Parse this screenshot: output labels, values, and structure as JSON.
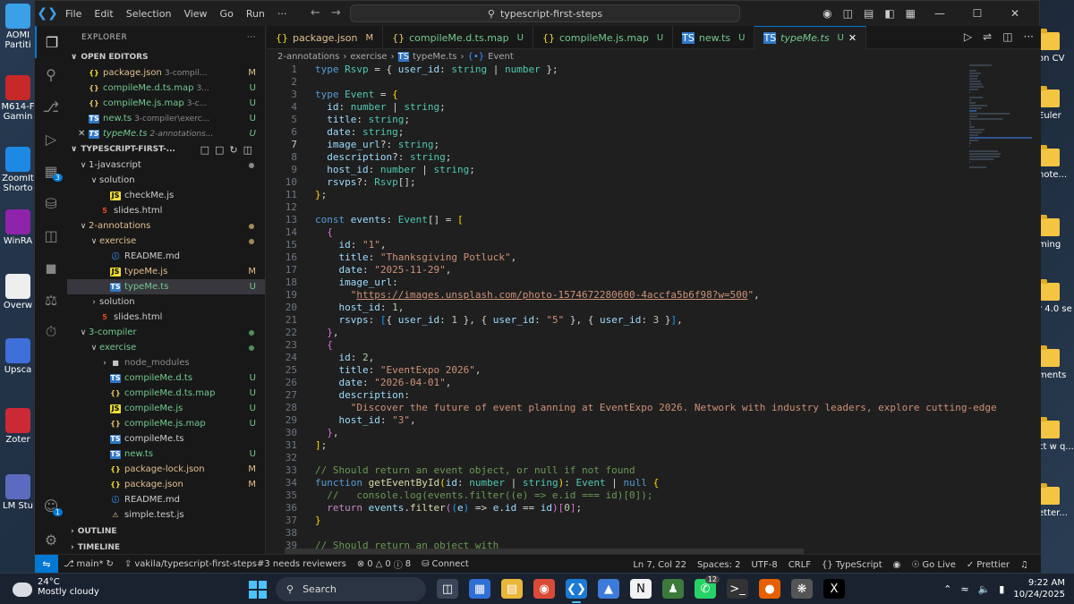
{
  "desktop": {
    "left_icons": [
      {
        "label": "AOMI Partiti",
        "color": "#3aa0e8"
      },
      {
        "label": "M614-F Gamin",
        "color": "#c62828"
      },
      {
        "label": "ZoomIt Shorto",
        "color": "#1e88e5"
      },
      {
        "label": "WinRA",
        "color": "#8e24aa"
      },
      {
        "label": "Overw",
        "color": "#eeeeee"
      },
      {
        "label": "Upsca",
        "color": "#3f6fd8"
      },
      {
        "label": "Zoter",
        "color": "#cc2936"
      },
      {
        "label": "LM Stu",
        "color": "#5c6bc0"
      }
    ],
    "right_icons": [
      {
        "label": "on CV"
      },
      {
        "label": "Euler"
      },
      {
        "label": "note..."
      },
      {
        "label": "ming"
      },
      {
        "label": "r 4.0 se"
      },
      {
        "label": "ments"
      },
      {
        "label": "ct w q..."
      },
      {
        "label": "etter..."
      }
    ]
  },
  "titlebar": {
    "menu": [
      "File",
      "Edit",
      "Selection",
      "View",
      "Go",
      "Run",
      "···"
    ],
    "search": "typescript-first-steps"
  },
  "activity": {
    "extensions_badge": "3",
    "accounts_badge": "1"
  },
  "sidebar": {
    "title": "EXPLORER",
    "open_editors_label": "OPEN EDITORS",
    "open_editors": [
      {
        "name": "package.json",
        "path": "3-compil...",
        "status": "M",
        "icon": "json"
      },
      {
        "name": "compileMe.d.ts.map",
        "path": "3...",
        "status": "U",
        "icon": "map"
      },
      {
        "name": "compileMe.js.map",
        "path": "3-c...",
        "status": "U",
        "icon": "map"
      },
      {
        "name": "new.ts",
        "path": "3-compiler\\exerc...",
        "status": "U",
        "icon": "ts"
      },
      {
        "name": "typeMe.ts",
        "path": "2-annotations...",
        "status": "U",
        "icon": "ts",
        "italic": true,
        "close": "✕"
      }
    ],
    "workspace_label": "TYPESCRIPT-FIRST-...",
    "tree": [
      {
        "name": "1-javascript",
        "depth": 1,
        "arrow": "∨",
        "dot": "#8a8a8a"
      },
      {
        "name": "solution",
        "depth": 2,
        "arrow": "∨"
      },
      {
        "name": "checkMe.js",
        "depth": 3,
        "icon": "js"
      },
      {
        "name": "slides.html",
        "depth": 2,
        "icon": "html"
      },
      {
        "name": "2-annotations",
        "depth": 1,
        "arrow": "∨",
        "dot": "#a08a5a",
        "color": "#e2c08d"
      },
      {
        "name": "exercise",
        "depth": 2,
        "arrow": "∨",
        "dot": "#a08a5a",
        "color": "#e2c08d"
      },
      {
        "name": "README.md",
        "depth": 3,
        "icon": "info"
      },
      {
        "name": "typeMe.js",
        "depth": 3,
        "icon": "js",
        "status": "M",
        "color": "#e2c08d"
      },
      {
        "name": "typeMe.ts",
        "depth": 3,
        "icon": "ts",
        "status": "U",
        "color": "#73c991",
        "selected": true
      },
      {
        "name": "solution",
        "depth": 2,
        "arrow": "›"
      },
      {
        "name": "slides.html",
        "depth": 2,
        "icon": "html"
      },
      {
        "name": "3-compiler",
        "depth": 1,
        "arrow": "∨",
        "dot": "#4f8f5f",
        "color": "#73c991"
      },
      {
        "name": "exercise",
        "depth": 2,
        "arrow": "∨",
        "dot": "#4f8f5f",
        "color": "#73c991"
      },
      {
        "name": "node_modules",
        "depth": 3,
        "arrow": "›",
        "icon": "folder",
        "color": "#8c8c8c"
      },
      {
        "name": "compileMe.d.ts",
        "depth": 3,
        "icon": "ts",
        "status": "U",
        "color": "#73c991"
      },
      {
        "name": "compileMe.d.ts.map",
        "depth": 3,
        "icon": "map",
        "status": "U",
        "color": "#73c991"
      },
      {
        "name": "compileMe.js",
        "depth": 3,
        "icon": "js",
        "status": "U",
        "color": "#73c991"
      },
      {
        "name": "compileMe.js.map",
        "depth": 3,
        "icon": "map",
        "status": "U",
        "color": "#73c991"
      },
      {
        "name": "compileMe.ts",
        "depth": 3,
        "icon": "ts"
      },
      {
        "name": "new.ts",
        "depth": 3,
        "icon": "ts",
        "status": "U",
        "color": "#73c991"
      },
      {
        "name": "package-lock.json",
        "depth": 3,
        "icon": "json",
        "status": "M",
        "color": "#e2c08d"
      },
      {
        "name": "package.json",
        "depth": 3,
        "icon": "json",
        "status": "M",
        "color": "#e2c08d"
      },
      {
        "name": "README.md",
        "depth": 3,
        "icon": "info"
      },
      {
        "name": "simple.test.js",
        "depth": 3,
        "icon": "test"
      }
    ],
    "outline_label": "OUTLINE",
    "timeline_label": "TIMELINE"
  },
  "tabs": [
    {
      "name": "package.json",
      "status": "M",
      "icon": "json"
    },
    {
      "name": "compileMe.d.ts.map",
      "status": "U",
      "icon": "map"
    },
    {
      "name": "compileMe.js.map",
      "status": "U",
      "icon": "json"
    },
    {
      "name": "new.ts",
      "status": "U",
      "icon": "ts"
    },
    {
      "name": "typeMe.ts",
      "status": "U",
      "icon": "ts",
      "active": true,
      "close": "✕"
    }
  ],
  "breadcrumbs": [
    "2-annotations",
    "exercise",
    "typeMe.ts",
    "Event"
  ],
  "code": {
    "current_line": 7,
    "lines": [
      [
        [
          "k",
          "type "
        ],
        [
          "t",
          "Rsvp"
        ],
        [
          "o",
          " = { "
        ],
        [
          "p",
          "user_id"
        ],
        [
          "o",
          ": "
        ],
        [
          "t",
          "string"
        ],
        [
          "o",
          " | "
        ],
        [
          "t",
          "number"
        ],
        [
          "o",
          " };"
        ]
      ],
      [],
      [
        [
          "k",
          "type "
        ],
        [
          "t",
          "Event"
        ],
        [
          "o",
          " = "
        ],
        [
          "y",
          "{"
        ]
      ],
      [
        [
          "o",
          "  "
        ],
        [
          "p",
          "id"
        ],
        [
          "o",
          ": "
        ],
        [
          "t",
          "number"
        ],
        [
          "o",
          " | "
        ],
        [
          "t",
          "string"
        ],
        [
          "o",
          ";"
        ]
      ],
      [
        [
          "o",
          "  "
        ],
        [
          "p",
          "title"
        ],
        [
          "o",
          ": "
        ],
        [
          "t",
          "string"
        ],
        [
          "o",
          ";"
        ]
      ],
      [
        [
          "o",
          "  "
        ],
        [
          "p",
          "date"
        ],
        [
          "o",
          ": "
        ],
        [
          "t",
          "string"
        ],
        [
          "o",
          ";"
        ]
      ],
      [
        [
          "o",
          "  "
        ],
        [
          "p",
          "image_url"
        ],
        [
          "o",
          "?: "
        ],
        [
          "t",
          "string"
        ],
        [
          "o",
          ";"
        ]
      ],
      [
        [
          "o",
          "  "
        ],
        [
          "p",
          "description"
        ],
        [
          "o",
          "?: "
        ],
        [
          "t",
          "string"
        ],
        [
          "o",
          ";"
        ]
      ],
      [
        [
          "o",
          "  "
        ],
        [
          "p",
          "host_id"
        ],
        [
          "o",
          ": "
        ],
        [
          "t",
          "number"
        ],
        [
          "o",
          " | "
        ],
        [
          "t",
          "string"
        ],
        [
          "o",
          ";"
        ]
      ],
      [
        [
          "o",
          "  "
        ],
        [
          "p",
          "rsvps"
        ],
        [
          "o",
          "?: "
        ],
        [
          "t",
          "Rsvp"
        ],
        [
          "o",
          "[];"
        ]
      ],
      [
        [
          "y",
          "}"
        ],
        [
          "o",
          ";"
        ]
      ],
      [],
      [
        [
          "k",
          "const "
        ],
        [
          "p",
          "events"
        ],
        [
          "o",
          ": "
        ],
        [
          "t",
          "Event"
        ],
        [
          "o",
          "[] = "
        ],
        [
          "y",
          "["
        ]
      ],
      [
        [
          "o",
          "  "
        ],
        [
          "m",
          "{"
        ]
      ],
      [
        [
          "o",
          "    "
        ],
        [
          "p",
          "id"
        ],
        [
          "o",
          ": "
        ],
        [
          "s",
          "\"1\""
        ],
        [
          "o",
          ","
        ]
      ],
      [
        [
          "o",
          "    "
        ],
        [
          "p",
          "title"
        ],
        [
          "o",
          ": "
        ],
        [
          "s",
          "\"Thanksgiving Potluck\""
        ],
        [
          "o",
          ","
        ]
      ],
      [
        [
          "o",
          "    "
        ],
        [
          "p",
          "date"
        ],
        [
          "o",
          ": "
        ],
        [
          "s",
          "\"2025-11-29\""
        ],
        [
          "o",
          ","
        ]
      ],
      [
        [
          "o",
          "    "
        ],
        [
          "p",
          "image_url"
        ],
        [
          "o",
          ":"
        ]
      ],
      [
        [
          "o",
          "      "
        ],
        [
          "s",
          "\""
        ],
        [
          "u",
          "https://images.unsplash.com/photo-1574672280600-4accfa5b6f98?w=500"
        ],
        [
          "s",
          "\""
        ],
        [
          "o",
          ","
        ]
      ],
      [
        [
          "o",
          "    "
        ],
        [
          "p",
          "host_id"
        ],
        [
          "o",
          ": "
        ],
        [
          "n",
          "1"
        ],
        [
          "o",
          ","
        ]
      ],
      [
        [
          "o",
          "    "
        ],
        [
          "p",
          "rsvps"
        ],
        [
          "o",
          ": "
        ],
        [
          "bl",
          "["
        ],
        [
          "o",
          "{ "
        ],
        [
          "p",
          "user_id"
        ],
        [
          "o",
          ": "
        ],
        [
          "n",
          "1"
        ],
        [
          "o",
          " }, { "
        ],
        [
          "p",
          "user_id"
        ],
        [
          "o",
          ": "
        ],
        [
          "s",
          "\"5\""
        ],
        [
          "o",
          " }, { "
        ],
        [
          "p",
          "user_id"
        ],
        [
          "o",
          ": "
        ],
        [
          "n",
          "3"
        ],
        [
          "o",
          " }"
        ],
        [
          "bl",
          "]"
        ],
        [
          "o",
          ","
        ]
      ],
      [
        [
          "o",
          "  "
        ],
        [
          "m",
          "}"
        ],
        [
          "o",
          ","
        ]
      ],
      [
        [
          "o",
          "  "
        ],
        [
          "m",
          "{"
        ]
      ],
      [
        [
          "o",
          "    "
        ],
        [
          "p",
          "id"
        ],
        [
          "o",
          ": "
        ],
        [
          "n",
          "2"
        ],
        [
          "o",
          ","
        ]
      ],
      [
        [
          "o",
          "    "
        ],
        [
          "p",
          "title"
        ],
        [
          "o",
          ": "
        ],
        [
          "s",
          "\"EventExpo 2026\""
        ],
        [
          "o",
          ","
        ]
      ],
      [
        [
          "o",
          "    "
        ],
        [
          "p",
          "date"
        ],
        [
          "o",
          ": "
        ],
        [
          "s",
          "\"2026-04-01\""
        ],
        [
          "o",
          ","
        ]
      ],
      [
        [
          "o",
          "    "
        ],
        [
          "p",
          "description"
        ],
        [
          "o",
          ":"
        ]
      ],
      [
        [
          "o",
          "      "
        ],
        [
          "s",
          "\"Discover the future of event planning at EventExpo 2026. Network with industry leaders, explore cutting-edge t"
        ]
      ],
      [
        [
          "o",
          "    "
        ],
        [
          "p",
          "host_id"
        ],
        [
          "o",
          ": "
        ],
        [
          "s",
          "\"3\""
        ],
        [
          "o",
          ","
        ]
      ],
      [
        [
          "o",
          "  "
        ],
        [
          "m",
          "}"
        ],
        [
          "o",
          ","
        ]
      ],
      [
        [
          "y",
          "]"
        ],
        [
          "o",
          ";"
        ]
      ],
      [],
      [
        [
          "c",
          "// Should return an event object, or null if not found"
        ]
      ],
      [
        [
          "k",
          "function "
        ],
        [
          "f",
          "getEventById"
        ],
        [
          "y",
          "("
        ],
        [
          "p",
          "id"
        ],
        [
          "o",
          ": "
        ],
        [
          "t",
          "number"
        ],
        [
          "o",
          " | "
        ],
        [
          "t",
          "string"
        ],
        [
          "y",
          ")"
        ],
        [
          "o",
          ": "
        ],
        [
          "t",
          "Event"
        ],
        [
          "o",
          " | "
        ],
        [
          "k",
          "null"
        ],
        [
          "o",
          " "
        ],
        [
          "y",
          "{"
        ]
      ],
      [
        [
          "o",
          "  "
        ],
        [
          "c",
          "//   console.log(events.filter((e) => e.id === id)[0]);"
        ]
      ],
      [
        [
          "o",
          "  "
        ],
        [
          "k2",
          "return "
        ],
        [
          "p",
          "events"
        ],
        [
          "o",
          "."
        ],
        [
          "f",
          "filter"
        ],
        [
          "m",
          "("
        ],
        [
          "bl",
          "("
        ],
        [
          "p",
          "e"
        ],
        [
          "bl",
          ")"
        ],
        [
          "o",
          " => "
        ],
        [
          "p",
          "e"
        ],
        [
          "o",
          "."
        ],
        [
          "p",
          "id"
        ],
        [
          "o",
          " == "
        ],
        [
          "p",
          "id"
        ],
        [
          "m",
          ")"
        ],
        [
          "m",
          "["
        ],
        [
          "n",
          "0"
        ],
        [
          "m",
          "]"
        ],
        [
          "o",
          ";"
        ]
      ],
      [
        [
          "y",
          "}"
        ]
      ],
      [],
      [
        [
          "c",
          "// Should return an object with"
        ]
      ]
    ]
  },
  "status": {
    "branch": "main*",
    "pr": "vakila/typescript-first-steps#3 needs reviewers",
    "errors": "0",
    "warnings": "0",
    "info": "8",
    "connect": "Connect",
    "position": "Ln 7, Col 22",
    "spaces": "Spaces: 2",
    "encoding": "UTF-8",
    "eol": "CRLF",
    "language": "TypeScript",
    "golive": "Go Live",
    "prettier": "Prettier"
  },
  "taskbar": {
    "temp": "24°C",
    "weather": "Mostly cloudy",
    "search": "Search",
    "whatsapp_badge": "12",
    "time": "9:22 AM",
    "date": "10/24/2025"
  },
  "colors": {
    "accent": "#0078d4",
    "modified": "#e2c08d",
    "untracked": "#73c991"
  }
}
